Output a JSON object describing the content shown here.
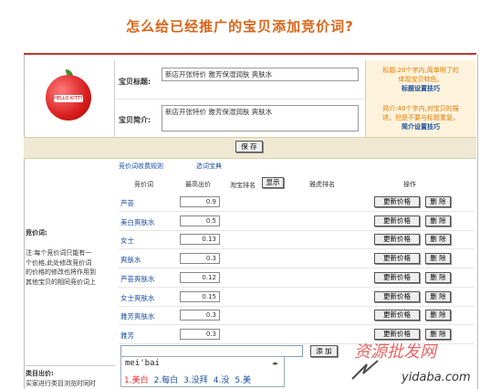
{
  "page_title": "怎么给已经推广的宝贝添加竞价词?",
  "product": {
    "image_text": "HELLO KITTY",
    "title_label": "宝贝标题:",
    "title_value": "新店开张特价 雅芳保湿润肤 爽肤水",
    "desc_label": "宝贝简介:",
    "desc_value": "新店开张特价 雅芳保湿润肤 爽肤水"
  },
  "hints": {
    "title_hint_1": "标题:20个字内,简单明了的",
    "title_hint_2": "体现宝贝特色。",
    "title_link": "标题设置技巧",
    "desc_hint_1": "简介:40个字内,对宝贝的描",
    "desc_hint_2": "述。但是不要与标题重复。",
    "desc_link": "简介设置技巧"
  },
  "save_button": "保 存",
  "links": {
    "rules": "竞价词收费规则",
    "pick": "选词宝典"
  },
  "table": {
    "headers": {
      "keyword": "竞价词",
      "max_bid": "最高出价",
      "tao_rank": "淘宝排名",
      "show": "显示",
      "yahoo_rank": "雅虎排名",
      "ops": "操作"
    },
    "update_label": "更新价格",
    "delete_label": "删 除",
    "rows": [
      {
        "keyword": "芦荟",
        "bid": "0.9"
      },
      {
        "keyword": "美白爽肤水",
        "bid": "0.5"
      },
      {
        "keyword": "女士",
        "bid": "0.13"
      },
      {
        "keyword": "爽肤水",
        "bid": "0.3"
      },
      {
        "keyword": "芦荟爽肤水",
        "bid": "0.12"
      },
      {
        "keyword": "女士爽肤水",
        "bid": "0.15"
      },
      {
        "keyword": "雅芳爽肤水",
        "bid": "0.3"
      },
      {
        "keyword": "雅芳",
        "bid": "0.3"
      }
    ],
    "add_label": "添 加"
  },
  "left_panel": {
    "heading": "竞价词:",
    "note_1": "注:每个竞价词只能有一",
    "note_2": "个价格,此处修改竞价词",
    "note_3": "的价格的修改也将作用到",
    "note_4": "其他宝贝的相同竞价词上",
    "bottom_heading": "类目出价:",
    "bottom_note": "买家进行类目浏览时同时"
  },
  "ime": {
    "input": "mei'bai",
    "arrows": "◂▸",
    "candidates": [
      "1.美白",
      "2.每白",
      "3.没拜",
      "4.没",
      "5.美"
    ]
  },
  "watermark": {
    "line1": "资源批发网",
    "line2": "yidaba.com"
  }
}
